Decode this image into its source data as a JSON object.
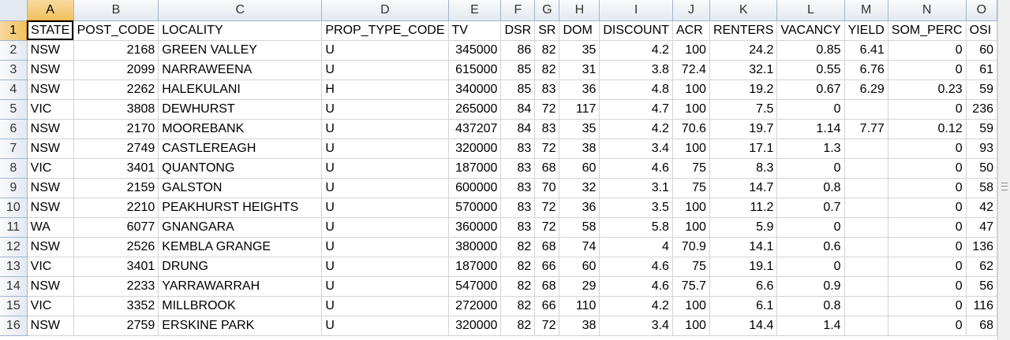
{
  "columns": [
    "A",
    "B",
    "C",
    "D",
    "E",
    "F",
    "G",
    "H",
    "I",
    "J",
    "K",
    "L",
    "M",
    "N",
    "O"
  ],
  "selected_column": "A",
  "selected_row": 1,
  "headers": [
    "STATE",
    "POST_CODE",
    "LOCALITY",
    "PROP_TYPE_CODE",
    "TV",
    "DSR",
    "SR",
    "DOM",
    "DISCOUNT",
    "ACR",
    "RENTERS",
    "VACANCY",
    "YIELD",
    "SOM_PERC",
    "OSI"
  ],
  "rows": [
    [
      "NSW",
      "2168",
      "GREEN VALLEY",
      "U",
      "345000",
      "86",
      "82",
      "35",
      "4.2",
      "100",
      "24.2",
      "0.85",
      "6.41",
      "0",
      "60"
    ],
    [
      "NSW",
      "2099",
      "NARRAWEENA",
      "U",
      "615000",
      "85",
      "82",
      "31",
      "3.8",
      "72.4",
      "32.1",
      "0.55",
      "6.76",
      "0",
      "61"
    ],
    [
      "NSW",
      "2262",
      "HALEKULANI",
      "H",
      "340000",
      "85",
      "83",
      "36",
      "4.8",
      "100",
      "19.2",
      "0.67",
      "6.29",
      "0.23",
      "59"
    ],
    [
      "VIC",
      "3808",
      "DEWHURST",
      "U",
      "265000",
      "84",
      "72",
      "117",
      "4.7",
      "100",
      "7.5",
      "0",
      "",
      "0",
      "236"
    ],
    [
      "NSW",
      "2170",
      "MOOREBANK",
      "U",
      "437207",
      "84",
      "83",
      "35",
      "4.2",
      "70.6",
      "19.7",
      "1.14",
      "7.77",
      "0.12",
      "59"
    ],
    [
      "NSW",
      "2749",
      "CASTLEREAGH",
      "U",
      "320000",
      "83",
      "72",
      "38",
      "3.4",
      "100",
      "17.1",
      "1.3",
      "",
      "0",
      "93"
    ],
    [
      "VIC",
      "3401",
      "QUANTONG",
      "U",
      "187000",
      "83",
      "68",
      "60",
      "4.6",
      "75",
      "8.3",
      "0",
      "",
      "0",
      "50"
    ],
    [
      "NSW",
      "2159",
      "GALSTON",
      "U",
      "600000",
      "83",
      "70",
      "32",
      "3.1",
      "75",
      "14.7",
      "0.8",
      "",
      "0",
      "58"
    ],
    [
      "NSW",
      "2210",
      "PEAKHURST HEIGHTS",
      "U",
      "570000",
      "83",
      "72",
      "36",
      "3.5",
      "100",
      "11.2",
      "0.7",
      "",
      "0",
      "42"
    ],
    [
      "WA",
      "6077",
      "GNANGARA",
      "U",
      "360000",
      "83",
      "72",
      "58",
      "5.8",
      "100",
      "5.9",
      "0",
      "",
      "0",
      "47"
    ],
    [
      "NSW",
      "2526",
      "KEMBLA GRANGE",
      "U",
      "380000",
      "82",
      "68",
      "74",
      "4",
      "70.9",
      "14.1",
      "0.6",
      "",
      "0",
      "136"
    ],
    [
      "VIC",
      "3401",
      "DRUNG",
      "U",
      "187000",
      "82",
      "66",
      "60",
      "4.6",
      "75",
      "19.1",
      "0",
      "",
      "0",
      "62"
    ],
    [
      "NSW",
      "2233",
      "YARRAWARRAH",
      "U",
      "547000",
      "82",
      "68",
      "29",
      "4.6",
      "75.7",
      "6.6",
      "0.9",
      "",
      "0",
      "56"
    ],
    [
      "VIC",
      "3352",
      "MILLBROOK",
      "U",
      "272000",
      "82",
      "66",
      "110",
      "4.2",
      "100",
      "6.1",
      "0.8",
      "",
      "0",
      "116"
    ],
    [
      "NSW",
      "2759",
      "ERSKINE PARK",
      "U",
      "320000",
      "82",
      "72",
      "38",
      "3.4",
      "100",
      "14.4",
      "1.4",
      "",
      "0",
      "68"
    ]
  ]
}
